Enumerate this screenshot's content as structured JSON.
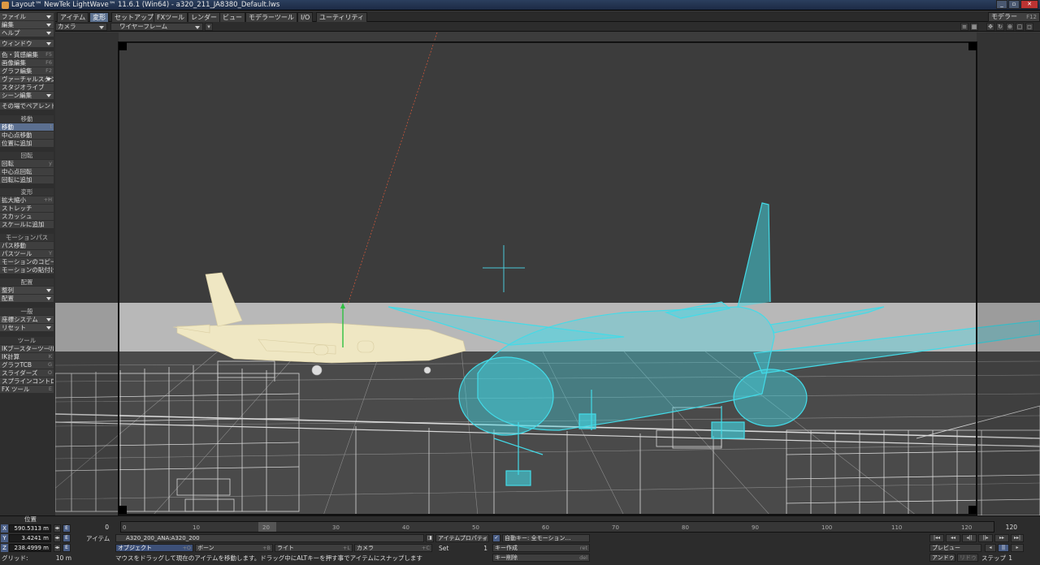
{
  "window": {
    "title": "Layout™ NewTek LightWave™ 11.6.1 (Win64) - a320_211_JA8380_Default.lws"
  },
  "top_tabs": [
    {
      "label": "アイテム"
    },
    {
      "label": "変形"
    },
    {
      "label": "セットアップ"
    },
    {
      "label": "FXツール"
    },
    {
      "label": "レンダー"
    },
    {
      "label": "ビュー"
    },
    {
      "label": "モデラーツール"
    },
    {
      "label": "I/O"
    },
    {
      "label": "ユーティリティ"
    }
  ],
  "active_tab": "変形",
  "modeler": {
    "label": "モデラー",
    "shortcut": "F12"
  },
  "left_toolbar": {
    "file": "ファイル",
    "edit": "編集",
    "help": "ヘルプ",
    "window": "ウィンドウ",
    "color_surface": "色・質感編集",
    "color_surface_sc": "F5",
    "image_edit": "画像編集",
    "image_edit_sc": "F6",
    "graph_edit": "グラフ編集",
    "graph_edit_sc": "F2",
    "virtual_studio": "ヴァーチャルスタジオ",
    "studio_live": "スタジオライブ",
    "scene_edit": "シーン編集",
    "parent_in_place": "その場でペアレント",
    "move_head": "移動",
    "move": "移動",
    "move_sc": "t",
    "move_pivot": "中心点移動",
    "add_to_position": "位置に追加",
    "rotate_head": "回転",
    "rotate": "回転",
    "rotate_sc": "y",
    "rotate_pivot": "中心点回転",
    "add_to_rotation": "回転に追加",
    "transform_head": "変形",
    "size": "拡大縮小",
    "size_sc": "+H",
    "stretch": "ストレッチ",
    "squash": "スカッシュ",
    "add_to_scale": "スケールに追加",
    "motion_path_head": "モーションパス",
    "path_move": "パス移動",
    "path_tool": "パスツール",
    "path_tool_sc": "Y",
    "copy_motion": "モーションのコピー",
    "paste_motion": "モーションの貼付け",
    "layout_head": "配置",
    "align": "整列",
    "arrange": "配置",
    "general_head": "一般",
    "coord_system": "座標システム",
    "reset": "リセット",
    "tools_head": "ツール",
    "ik_booster": "IKブースターツール",
    "ik_booster_sc": "B",
    "ik_solve": "IK計算",
    "ik_solve_sc": "K",
    "graph_tcb": "グラフTCB",
    "graph_tcb_sc": "G",
    "sliders": "スライダーズ",
    "sliders_sc": "O",
    "spline_control": "スプラインコントロール",
    "fx_tool": "FX ツール",
    "fx_tool_sc": "E"
  },
  "viewport": {
    "view_dropdown": "カメラ",
    "render_dropdown": "ワイヤーフレーム"
  },
  "position": {
    "label": "位置",
    "x": "590.5313 m",
    "y": "3.4241 m",
    "z": "238.4999 m",
    "grid_label": "グリッド:",
    "grid_value": "10 m"
  },
  "timeline": {
    "start": "0",
    "end": "120",
    "current": "20",
    "ticks": [
      "0",
      "10",
      "20",
      "30",
      "40",
      "50",
      "60",
      "70",
      "80",
      "90",
      "100",
      "110",
      "120"
    ]
  },
  "bottom_bar": {
    "item_label": "アイテム",
    "current_item": "A320_200_ANA:A320_200",
    "item_properties": "アイテムプロパティ",
    "item_properties_sc": "p",
    "objects": "オブジェクト",
    "objects_sc": "+O",
    "bones": "ボーン",
    "bones_sc": "+B",
    "lights": "ライト",
    "lights_sc": "+L",
    "cameras": "カメラ",
    "cameras_sc": "+C",
    "set_label": "Set",
    "set_value": "1",
    "auto_key": "自動キー: 全モーション…",
    "create_key": "キー作成",
    "create_key_sc": "ret",
    "delete_key": "キー削除",
    "delete_key_sc": "del",
    "status": "マウスをドラッグして現在のアイテムを移動します。ドラッグ中にALTキーを押す事でアイテムにスナップします",
    "preview": "プレビュー",
    "step_label": "ステップ",
    "step_value": "1",
    "undo": "アンドゥ",
    "redo": "リドゥ"
  }
}
